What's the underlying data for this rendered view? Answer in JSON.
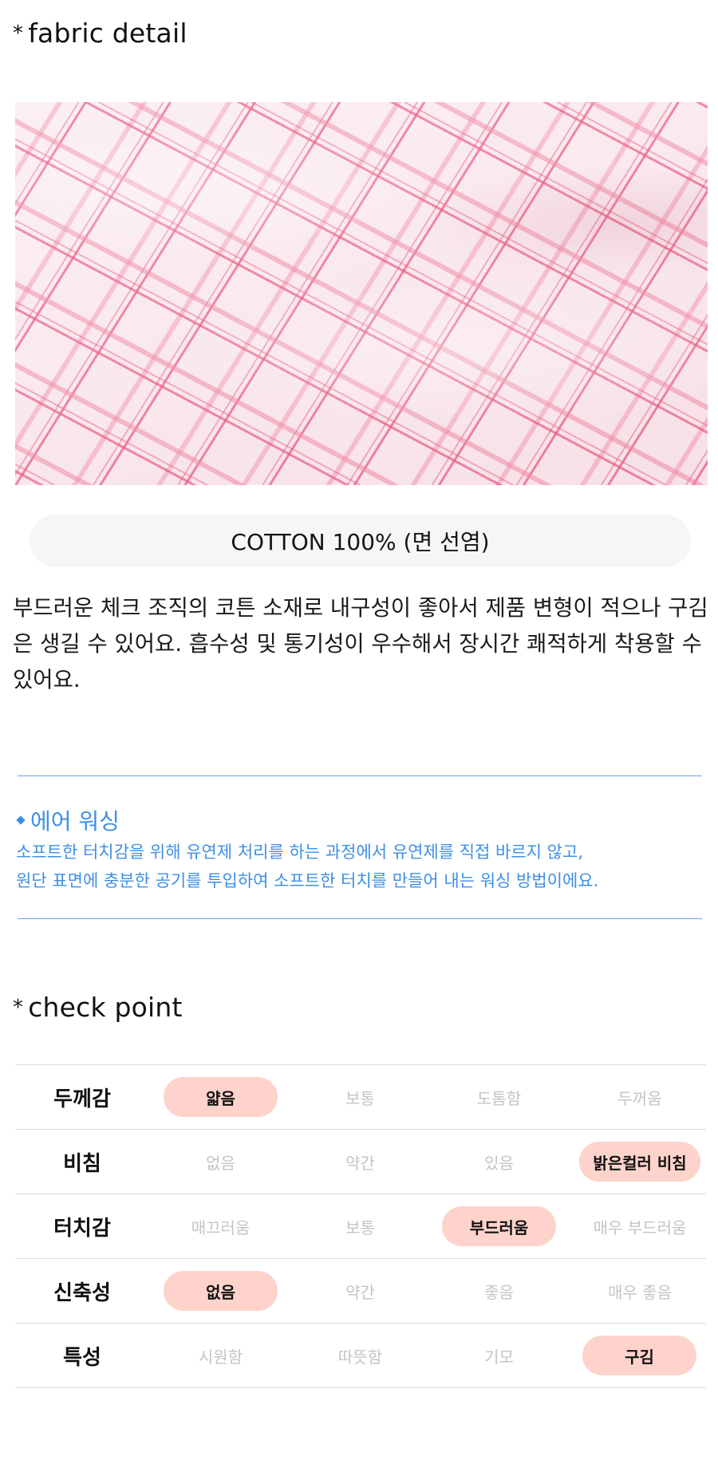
{
  "fabric_section": {
    "star": "*",
    "title": "fabric detail",
    "material": "COTTON 100% (면 선염)",
    "description": "부드러운 체크 조직의 코튼 소재로 내구성이 좋아서 제품 변형이 적으나 구김은 생길 수 있어요. 흡수성 및 통기성이 우수해서 장시간 쾌적하게 착용할 수 있어요."
  },
  "info_box": {
    "accent_color": "#3d8fe6",
    "heading": "에어 워싱",
    "line1": "소프트한 터치감을 위해 유연제 처리를 하는 과정에서 유연제를 직접 바르지 않고,",
    "line2": "원단 표면에 충분한 공기를 투입하여 소프트한 터치를 만들어 내는 워싱 방법이에요."
  },
  "check_section": {
    "star": "*",
    "title": "check point",
    "highlight_color": "#fdd3cb",
    "rows": [
      {
        "label": "두께감",
        "options": [
          "얇음",
          "보통",
          "도톰함",
          "두꺼움"
        ],
        "selected": 0
      },
      {
        "label": "비침",
        "options": [
          "없음",
          "약간",
          "있음",
          "밝은컬러 비침"
        ],
        "selected": 3
      },
      {
        "label": "터치감",
        "options": [
          "매끄러움",
          "보통",
          "부드러움",
          "매우 부드러움"
        ],
        "selected": 2
      },
      {
        "label": "신축성",
        "options": [
          "없음",
          "약간",
          "좋음",
          "매우 좋음"
        ],
        "selected": 0
      },
      {
        "label": "특성",
        "options": [
          "시원함",
          "따뜻함",
          "기모",
          "구김"
        ],
        "selected": 3
      }
    ]
  }
}
